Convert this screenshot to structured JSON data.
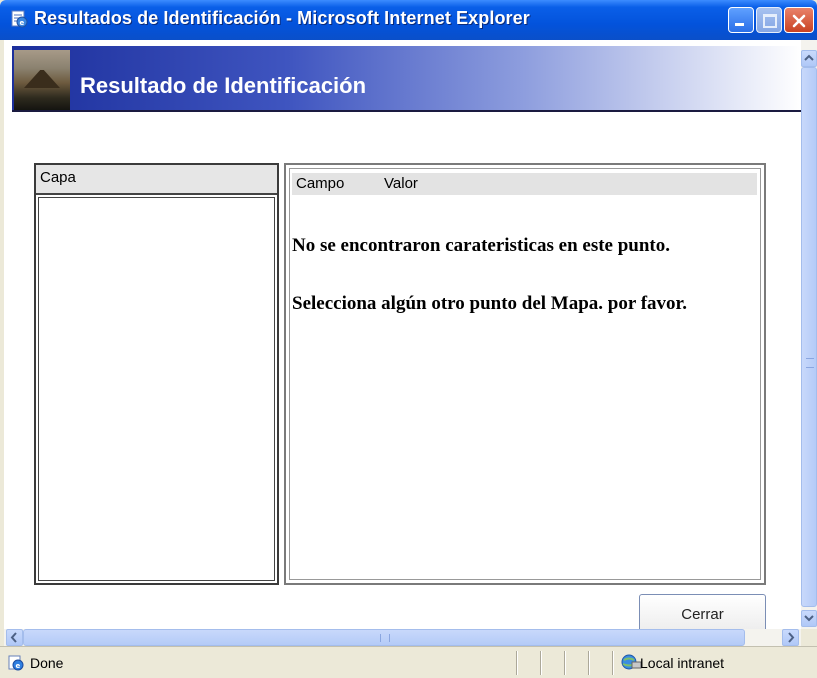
{
  "window": {
    "title": "Resultados de Identificación - Microsoft Internet Explorer"
  },
  "banner": {
    "title": "Resultado de Identificación"
  },
  "left_panel": {
    "header": "Capa"
  },
  "right_panel": {
    "columns": [
      "Campo",
      "Valor"
    ],
    "message_line1": "No se encontraron carateristicas en este punto.",
    "message_line2": "Selecciona algún otro punto del Mapa. por favor."
  },
  "buttons": {
    "close_label": "Cerrar"
  },
  "statusbar": {
    "status": "Done",
    "zone": "Local intranet"
  },
  "icons": {
    "title": "ie-page-icon",
    "status": "ie-done-icon",
    "zone": "intranet-globe-icon"
  },
  "colors": {
    "titlebar": "#0353dc",
    "banner_start": "#1c2f9c",
    "close_button": "#c94223"
  }
}
